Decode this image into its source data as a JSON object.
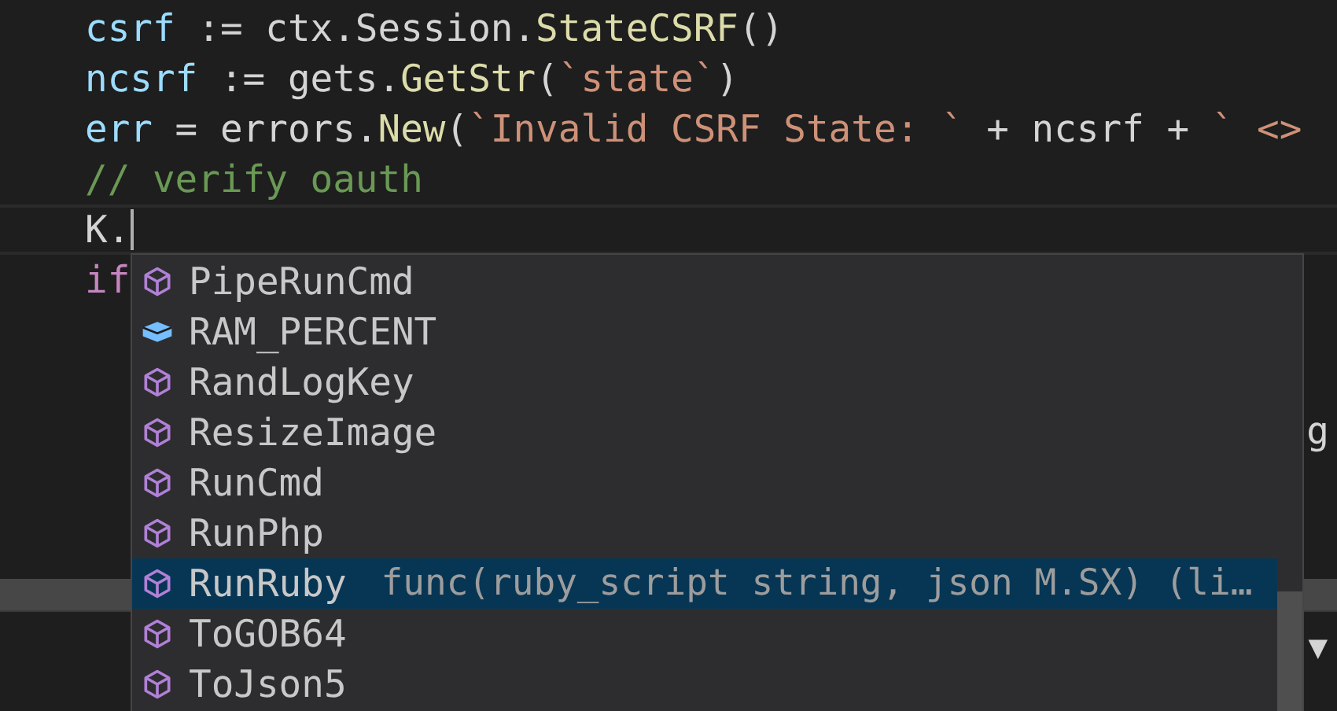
{
  "editor": {
    "lines": [
      {
        "tokens": [
          {
            "text": "csrf",
            "kind": "variable"
          },
          {
            "text": " := ctx.Session.",
            "kind": "plain"
          },
          {
            "text": "StateCSRF",
            "kind": "function"
          },
          {
            "text": "()",
            "kind": "plain"
          }
        ]
      },
      {
        "tokens": [
          {
            "text": "ncsrf",
            "kind": "variable"
          },
          {
            "text": " := gets.",
            "kind": "plain"
          },
          {
            "text": "GetStr",
            "kind": "function"
          },
          {
            "text": "(",
            "kind": "plain"
          },
          {
            "text": "`state`",
            "kind": "string"
          },
          {
            "text": ")",
            "kind": "plain"
          }
        ]
      },
      {
        "tokens": [
          {
            "text": "err",
            "kind": "variable"
          },
          {
            "text": " = errors.",
            "kind": "plain"
          },
          {
            "text": "New",
            "kind": "function"
          },
          {
            "text": "(",
            "kind": "plain"
          },
          {
            "text": "`Invalid CSRF State: `",
            "kind": "string"
          },
          {
            "text": " + ncsrf + ",
            "kind": "plain"
          },
          {
            "text": "` <> ",
            "kind": "string"
          }
        ]
      },
      {
        "tokens": [
          {
            "text": "// verify oauth",
            "kind": "comment"
          }
        ]
      },
      {
        "current": true,
        "tokens": [
          {
            "text": "K.",
            "kind": "plain"
          }
        ]
      },
      {
        "tokens": [
          {
            "text": "if",
            "kind": "keyword"
          }
        ]
      },
      {
        "tokens": [
          {
            "text": "g",
            "kind": "plain"
          }
        ]
      }
    ]
  },
  "suggestions": [
    {
      "label": "PipeRunCmd",
      "kind": "function",
      "selected": false
    },
    {
      "label": "RAM_PERCENT",
      "kind": "constant",
      "selected": false
    },
    {
      "label": "RandLogKey",
      "kind": "function",
      "selected": false
    },
    {
      "label": "ResizeImage",
      "kind": "function",
      "selected": false
    },
    {
      "label": "RunCmd",
      "kind": "function",
      "selected": false
    },
    {
      "label": "RunPhp",
      "kind": "function",
      "selected": false
    },
    {
      "label": "RunRuby",
      "kind": "function",
      "selected": true,
      "detail": "func(ruby_script string, json M.SX) (li…"
    },
    {
      "label": "ToGOB64",
      "kind": "function",
      "selected": false
    },
    {
      "label": "ToJson5",
      "kind": "function",
      "selected": false
    }
  ],
  "panel": {
    "toggle": "▼"
  }
}
